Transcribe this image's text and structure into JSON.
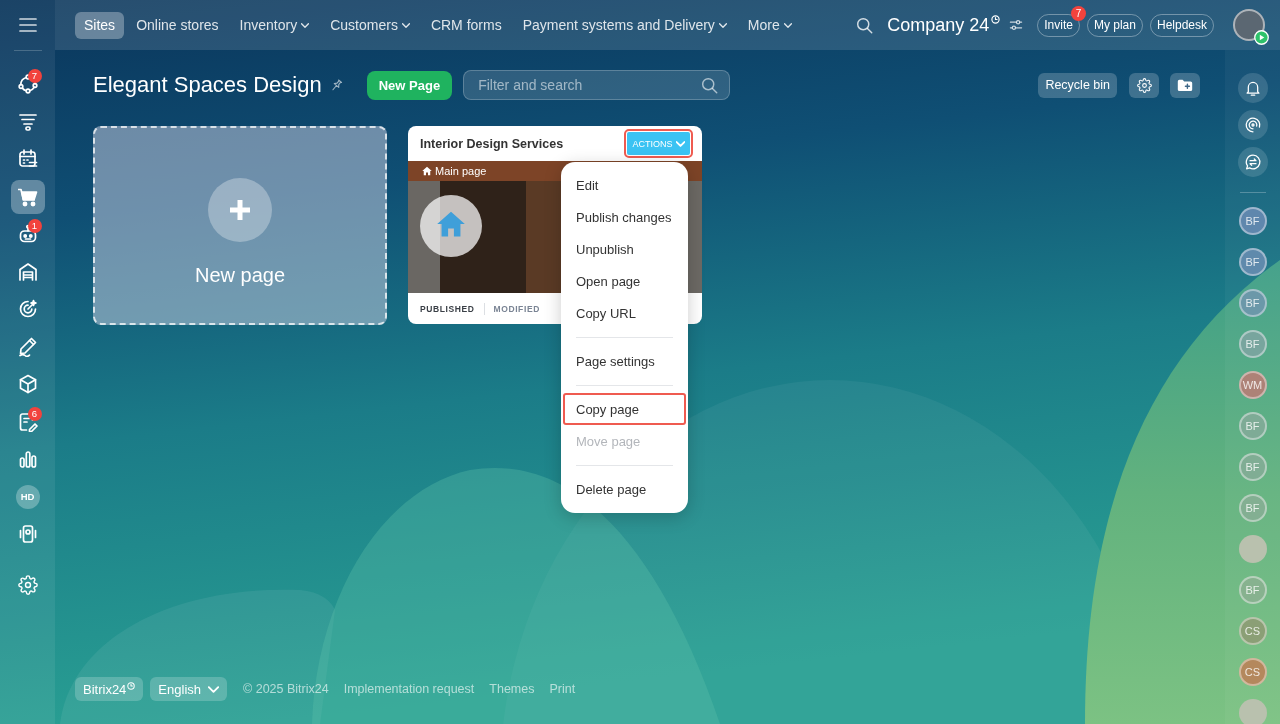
{
  "top_nav": {
    "tabs": [
      {
        "label": "Sites",
        "selected": true,
        "dropdown": false
      },
      {
        "label": "Online stores",
        "selected": false,
        "dropdown": false
      },
      {
        "label": "Inventory",
        "selected": false,
        "dropdown": true
      },
      {
        "label": "Customers",
        "selected": false,
        "dropdown": true
      },
      {
        "label": "CRM forms",
        "selected": false,
        "dropdown": false
      },
      {
        "label": "Payment systems and Delivery",
        "selected": false,
        "dropdown": true
      },
      {
        "label": "More",
        "selected": false,
        "dropdown": true
      }
    ]
  },
  "header": {
    "company": "Company 24",
    "invite": {
      "label": "Invite",
      "badge": "7"
    },
    "buttons": [
      "My plan",
      "Helpdesk"
    ]
  },
  "sidebar": {
    "items": [
      {
        "kind": "icon",
        "selected": false,
        "badge": "7"
      },
      {
        "kind": "icon",
        "selected": false
      },
      {
        "kind": "icon",
        "selected": false
      },
      {
        "kind": "icon",
        "selected": true
      },
      {
        "kind": "icon",
        "selected": false,
        "badge": "1"
      },
      {
        "kind": "icon",
        "selected": false
      },
      {
        "kind": "icon",
        "selected": false
      },
      {
        "kind": "icon",
        "selected": false
      },
      {
        "kind": "icon",
        "selected": false
      },
      {
        "kind": "icon",
        "selected": false,
        "badge": "6"
      },
      {
        "kind": "icon",
        "selected": false
      },
      {
        "kind": "avatar",
        "initials": "HD",
        "selected": false
      },
      {
        "kind": "icon",
        "selected": false
      },
      {
        "kind": "icon",
        "selected": false
      }
    ]
  },
  "page": {
    "title": "Elegant Spaces Design",
    "new_page_button": "New Page",
    "search": {
      "placeholder": "Filter and search"
    },
    "recycle_bin": "Recycle bin"
  },
  "tiles": {
    "new_page": {
      "label": "New page"
    },
    "site_card": {
      "title": "Interior Design Services",
      "actions": {
        "label": "ACTIONS",
        "highlighted": true
      },
      "preview": {
        "page_label": "Main page"
      },
      "status": [
        {
          "label": "PUBLISHED",
          "active": true
        },
        {
          "label": "MODIFIED",
          "active": false
        }
      ]
    }
  },
  "actions_menu": {
    "items": [
      {
        "kind": "item",
        "label": "Edit",
        "disabled": false,
        "highlighted": false
      },
      {
        "kind": "item",
        "label": "Publish changes",
        "disabled": false,
        "highlighted": false
      },
      {
        "kind": "item",
        "label": "Unpublish",
        "disabled": false,
        "highlighted": false
      },
      {
        "kind": "item",
        "label": "Open page",
        "disabled": false,
        "highlighted": false
      },
      {
        "kind": "item",
        "label": "Copy URL",
        "disabled": false,
        "highlighted": false
      },
      {
        "kind": "separator"
      },
      {
        "kind": "item",
        "label": "Page settings",
        "disabled": false,
        "highlighted": false
      },
      {
        "kind": "separator"
      },
      {
        "kind": "item",
        "label": "Copy page",
        "disabled": false,
        "highlighted": true
      },
      {
        "kind": "item",
        "label": "Move page",
        "disabled": true,
        "highlighted": false
      },
      {
        "kind": "separator"
      },
      {
        "kind": "item",
        "label": "Delete page",
        "disabled": false,
        "highlighted": false
      }
    ]
  },
  "right_panel": {
    "avatars": [
      {
        "kind": "initials",
        "initials": "BF",
        "color": "#5f87ad"
      },
      {
        "kind": "initials",
        "initials": "BF",
        "color": "#5f8aac"
      },
      {
        "kind": "initials",
        "initials": "BF",
        "color": "#6b98a9"
      },
      {
        "kind": "initials",
        "initials": "BF",
        "color": "#78a59e"
      },
      {
        "kind": "initials",
        "initials": "WM",
        "color": "#ad8277"
      },
      {
        "kind": "initials",
        "initials": "BF",
        "color": "#7eab96"
      },
      {
        "kind": "initials",
        "initials": "BF",
        "color": "#80ad94"
      },
      {
        "kind": "initials",
        "initials": "BF",
        "color": "#83af92"
      },
      {
        "kind": "photo"
      },
      {
        "kind": "initials",
        "initials": "BF",
        "color": "#87b28f"
      },
      {
        "kind": "initials",
        "initials": "CS",
        "color": "#8b9f76"
      },
      {
        "kind": "initials",
        "initials": "CS",
        "color": "#b4885d"
      },
      {
        "kind": "photo"
      }
    ]
  },
  "footer": {
    "brand": "Bitrix24",
    "language": "English",
    "copyright": "© 2025 Bitrix24",
    "links": [
      "Implementation request",
      "Themes",
      "Print"
    ]
  }
}
